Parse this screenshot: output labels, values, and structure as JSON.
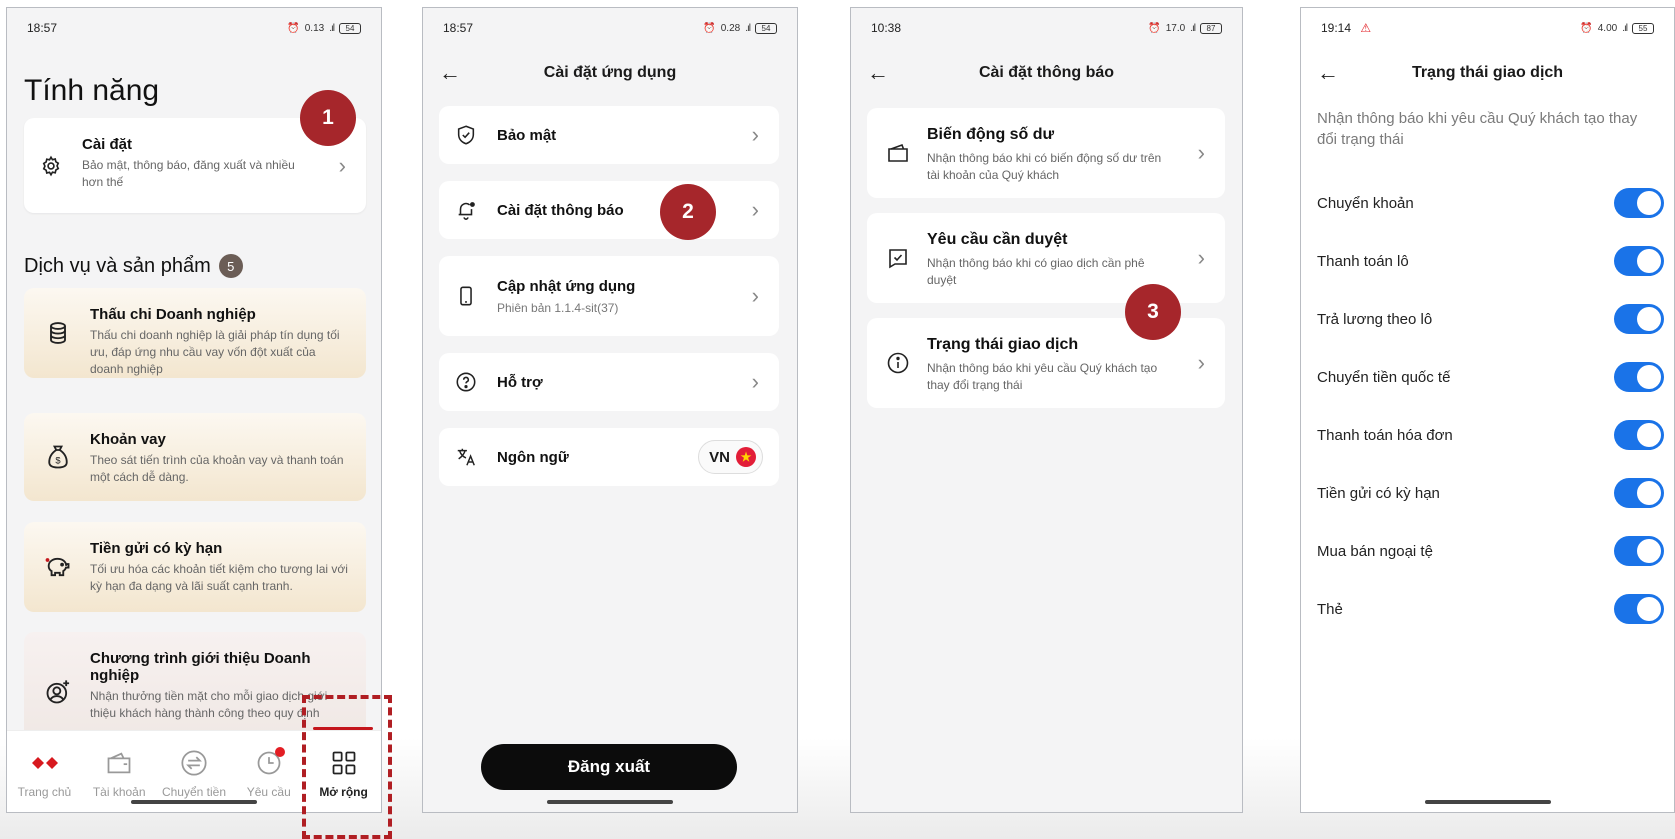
{
  "phone1": {
    "status": {
      "time": "18:57",
      "speed": "0.13",
      "battery": "54"
    },
    "title": "Tính năng",
    "settings_card": {
      "title": "Cài đặt",
      "subtitle": "Bảo mật, thông báo, đăng xuất và nhiều hơn thế"
    },
    "section": {
      "title": "Dịch vụ và sản phẩm",
      "count": "5"
    },
    "services": [
      {
        "title": "Thấu chi Doanh nghiệp",
        "subtitle": "Thấu chi doanh nghiệp là giải pháp tín dụng tối ưu, đáp ứng nhu cầu vay vốn đột xuất của doanh nghiệp",
        "icon": "coins-stack-icon"
      },
      {
        "title": "Khoản vay",
        "subtitle": "Theo sát tiến trình của khoản vay và thanh toán một cách dễ dàng.",
        "icon": "money-bag-icon"
      },
      {
        "title": "Tiền gửi có kỳ hạn",
        "subtitle": "Tối ưu hóa các khoản tiết kiệm cho tương lai với kỳ hạn đa dạng và lãi suất cạnh tranh.",
        "icon": "piggy-bank-icon"
      },
      {
        "title": "Chương trình giới thiệu Doanh nghiệp",
        "subtitle": "Nhận thưởng tiền mặt cho mỗi giao dịch giới thiệu khách hàng thành công theo quy định",
        "icon": "user-add-icon"
      }
    ],
    "nav": [
      {
        "label": "Trang chủ",
        "icon": "home-logo-icon",
        "active": false
      },
      {
        "label": "Tài khoản",
        "icon": "wallet-icon",
        "active": false
      },
      {
        "label": "Chuyển tiền",
        "icon": "transfer-icon",
        "active": false
      },
      {
        "label": "Yêu cầu",
        "icon": "clock-icon",
        "active": false
      },
      {
        "label": "Mở rộng",
        "icon": "grid-icon",
        "active": true
      }
    ],
    "step_badge": "1"
  },
  "phone2": {
    "status": {
      "time": "18:57",
      "speed": "0.28",
      "battery": "54"
    },
    "header": "Cài đặt ứng dụng",
    "rows": [
      {
        "title": "Bảo mật",
        "icon": "shield-check-icon"
      },
      {
        "title": "Cài đặt thông báo",
        "icon": "bell-icon"
      },
      {
        "title": "Cập nhật ứng dụng",
        "subtitle": "Phiên bản 1.1.4-sit(37)",
        "icon": "phone-icon"
      },
      {
        "title": "Hỗ trợ",
        "icon": "help-circle-icon"
      },
      {
        "title": "Ngôn ngữ",
        "icon": "translate-icon",
        "value": "VN"
      }
    ],
    "logout_label": "Đăng xuất",
    "step_badge": "2"
  },
  "phone3": {
    "status": {
      "time": "10:38",
      "speed": "17.0",
      "battery": "87"
    },
    "header": "Cài đặt thông báo",
    "items": [
      {
        "title": "Biến động số dư",
        "subtitle": "Nhận thông báo khi có biến động số dư trên tài khoản của Quý khách",
        "icon": "wallet-icon"
      },
      {
        "title": "Yêu cầu cần duyệt",
        "subtitle": "Nhận thông báo khi có giao dịch cần phê duyệt",
        "icon": "approval-icon"
      },
      {
        "title": "Trạng thái giao dịch",
        "subtitle": "Nhận thông báo khi yêu cầu Quý khách tạo thay đổi trạng thái",
        "icon": "info-icon"
      }
    ],
    "step_badge": "3"
  },
  "phone4": {
    "status": {
      "time": "19:14",
      "speed": "4.00",
      "battery": "55"
    },
    "header": "Trạng thái giao dịch",
    "intro": "Nhận thông báo khi yêu cầu Quý khách tạo thay đổi trạng thái",
    "toggles": [
      {
        "label": "Chuyển khoản",
        "on": true
      },
      {
        "label": "Thanh toán lô",
        "on": true
      },
      {
        "label": "Trả lương theo lô",
        "on": true
      },
      {
        "label": "Chuyển tiền quốc tế",
        "on": true
      },
      {
        "label": "Thanh toán hóa đơn",
        "on": true
      },
      {
        "label": "Tiền gửi có kỳ hạn",
        "on": true
      },
      {
        "label": "Mua bán ngoại tệ",
        "on": true
      },
      {
        "label": "Thẻ",
        "on": true
      }
    ]
  },
  "colors": {
    "brand_red": "#a6262b",
    "toggle_blue": "#1a73e8",
    "service_card": "#f3e6cf"
  }
}
